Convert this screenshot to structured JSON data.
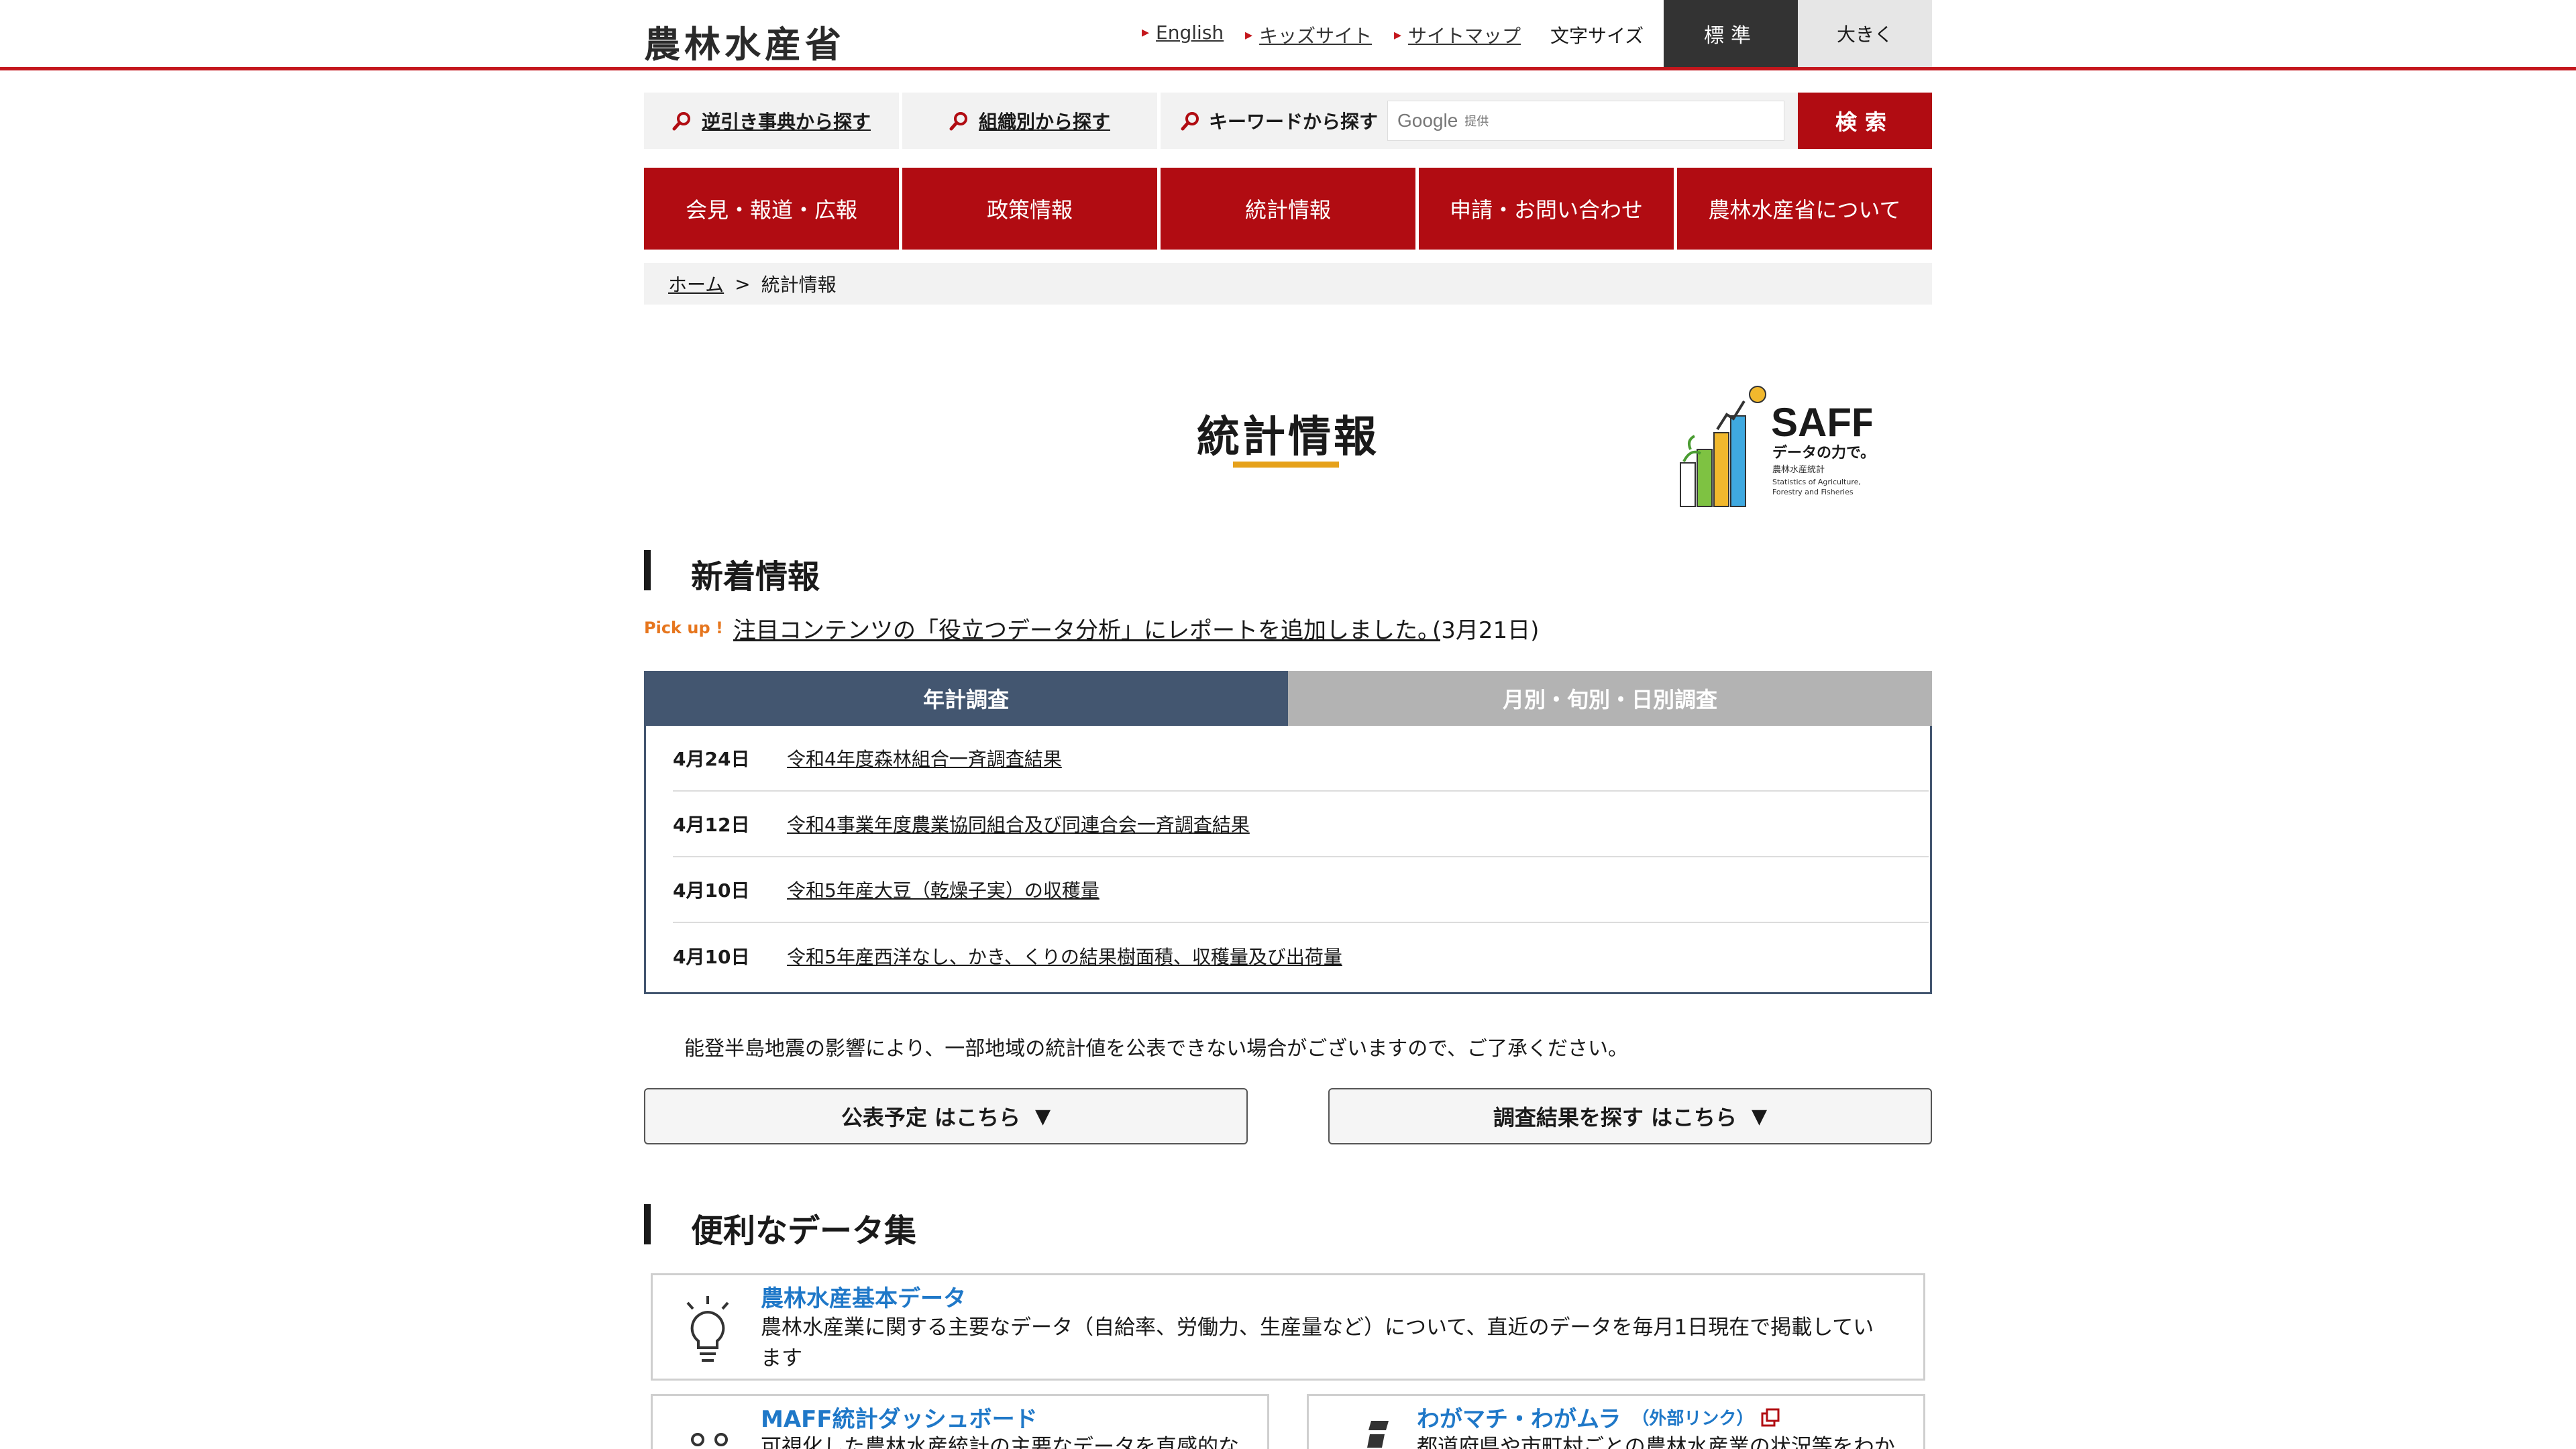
{
  "header": {
    "logo": "農林水産省",
    "links": [
      "English",
      "キッズサイト",
      "サイトマップ"
    ],
    "font_size_label": "文字サイズ",
    "font_standard": "標準",
    "font_large": "大きく"
  },
  "search": {
    "reverse_dict": "逆引き事典から探す",
    "by_org": "組織別から探す",
    "keyword_label": "キーワードから探す",
    "google_brand": "Google",
    "provided": "提供",
    "button": "検索"
  },
  "nav": [
    "会見・報道・広報",
    "政策情報",
    "統計情報",
    "申請・お問い合わせ",
    "農林水産省について"
  ],
  "breadcrumb": {
    "home": "ホーム",
    "sep": ">",
    "current": "統計情報"
  },
  "page_title": "統計情報",
  "saff": {
    "brand": "SAFF",
    "tagline": "データの力で。",
    "sub": "農林水産統計",
    "en1": "Statistics of Agriculture,",
    "en2": "Forestry and Fisheries"
  },
  "news": {
    "heading": "新着情報",
    "pickup_tag": "Pick up !",
    "pickup_text": "注目コンテンツの「役立つデータ分析」にレポートを追加しました。",
    "pickup_date": "(3月21日)",
    "tab_annual": "年計調査",
    "tab_monthly": "月別・旬別・日別調査",
    "items": [
      {
        "date": "4月24日",
        "title": "令和4年度森林組合一斉調査結果"
      },
      {
        "date": "4月12日",
        "title": "令和4事業年度農業協同組合及び同連合会一斉調査結果"
      },
      {
        "date": "4月10日",
        "title": "令和5年産大豆（乾燥子実）の収穫量"
      },
      {
        "date": "4月10日",
        "title": "令和5年産西洋なし、かき、くりの結果樹面積、収穫量及び出荷量"
      }
    ]
  },
  "notice": "能登半島地震の影響により、一部地域の統計値を公表できない場合がございますので、ご了承ください。",
  "buttons": {
    "schedule": "公表予定 はこちら",
    "search_results": "調査結果を探す はこちら",
    "arrow": "▼"
  },
  "data_section": {
    "heading": "便利なデータ集",
    "card1": {
      "title": "農林水産基本データ",
      "desc1": "農林水産業に関する主要なデータ（自給率、労働力、生産量など）について、直近のデータを毎月1日現在で掲載してい",
      "desc2": "ます"
    },
    "card2": {
      "title": "MAFF統計ダッシュボード",
      "desc": "可視化した農林水産統計の主要なデータを直感的な"
    },
    "card3": {
      "title": "わがマチ・わがムラ",
      "ext": "（外部リンク）",
      "desc": "都道府県や市町村ごとの農林水産業の状況等をわか"
    }
  }
}
